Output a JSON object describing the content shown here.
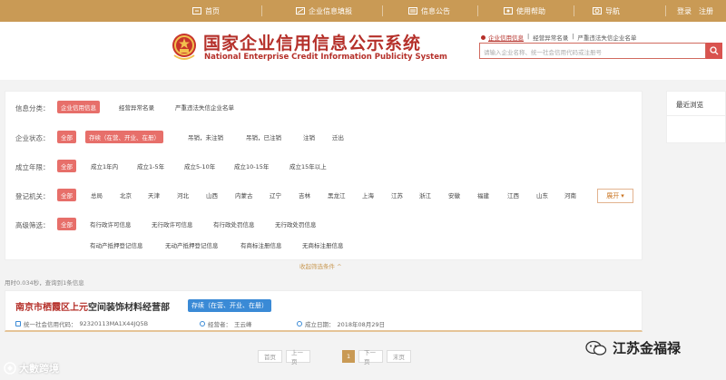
{
  "nav": {
    "items": [
      {
        "label": "首页",
        "icon": "home-icon"
      },
      {
        "label": "企业信息填报",
        "icon": "edit-icon"
      },
      {
        "label": "信息公告",
        "icon": "announce-icon"
      },
      {
        "label": "使用帮助",
        "icon": "help-icon"
      },
      {
        "label": "导航",
        "icon": "nav-icon"
      }
    ],
    "login": "登录",
    "register": "注册"
  },
  "header": {
    "title": "国家企业信用信息公示系统",
    "subtitle": "National Enterprise Credit Information Publicity System",
    "search_tabs": [
      "企业信用信息",
      "经营异常名录",
      "严重违法失信企业名单"
    ],
    "search_placeholder": "请输入企业名称、统一社会信用代码或注册号"
  },
  "filters": {
    "category": {
      "label": "信息分类：",
      "options": [
        "企业信用信息",
        "经营异常名录",
        "严重违法失信企业名单"
      ]
    },
    "status": {
      "label": "企业状态：",
      "options": [
        "全部",
        "存续（在营、开业、在册）",
        "吊销，未注销",
        "吊销，已注销",
        "注销",
        "迁出"
      ]
    },
    "age": {
      "label": "成立年限：",
      "options": [
        "全部",
        "成立1年内",
        "成立1-5年",
        "成立5-10年",
        "成立10-15年",
        "成立15年以上"
      ]
    },
    "authority": {
      "label": "登记机关：",
      "options": [
        "全部",
        "总局",
        "北京",
        "天津",
        "河北",
        "山西",
        "内蒙古",
        "辽宁",
        "吉林",
        "黑龙江",
        "上海",
        "江苏",
        "浙江",
        "安徽",
        "福建",
        "江西",
        "山东",
        "河南"
      ],
      "expand": "展开"
    },
    "advanced": {
      "label": "高级筛选：",
      "row1": [
        "全部",
        "有行政许可信息",
        "无行政许可信息",
        "有行政处罚信息",
        "无行政处罚信息"
      ],
      "row2": [
        "有动产抵押登记信息",
        "无动产抵押登记信息",
        "有商标注册信息",
        "无商标注册信息"
      ]
    },
    "collapse": "收起筛选条件 ^"
  },
  "sidebar": {
    "title": "最近浏览"
  },
  "results": {
    "summary": "用时0.034秒，查询到1条信息",
    "items": [
      {
        "name_highlight": "南京市栖霞区上元",
        "name_rest": "空间装饰材料经营部",
        "status": "存续（在营、开业、在册）",
        "code_label": "统一社会信用代码：",
        "code": "92320113MA1X44JQ5B",
        "operator_label": "经营者：",
        "operator": "王云峰",
        "date_label": "成立日期：",
        "date": "2018年08月29日"
      }
    ]
  },
  "pagination": {
    "first": "首页",
    "prev": "上一页",
    "current": "1",
    "next": "下一页",
    "last": "末页"
  },
  "watermark": {
    "left": "大數跨境",
    "right": "江苏金福禄"
  },
  "colors": {
    "nav_bg": "#c99a55",
    "brand_red": "#b5302a",
    "selected": "#e76f6a",
    "status_blue": "#3a8ad6"
  }
}
